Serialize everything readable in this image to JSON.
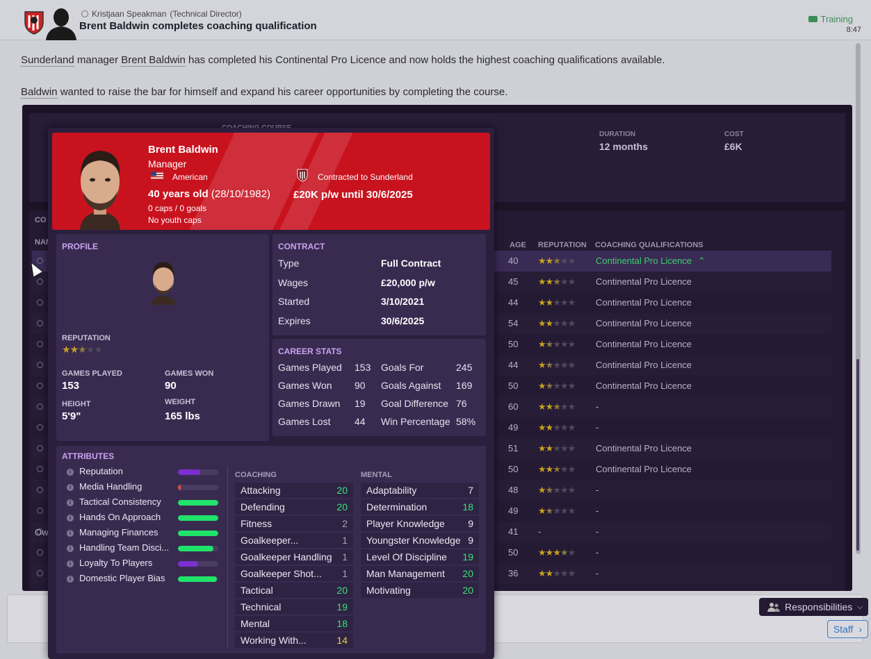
{
  "header": {
    "sender": "Kristjaan Speakman",
    "sender_role": "(Technical Director)",
    "subject": "Brent Baldwin completes coaching qualification",
    "category": "Training",
    "time": "8:47"
  },
  "message": {
    "p1": {
      "club": "Sunderland",
      "mid1": " manager ",
      "manager": "Brent Baldwin",
      "rest": " has completed his Continental Pro Licence and now holds the highest coaching qualifications available."
    },
    "p2": {
      "name": "Baldwin",
      "rest": " wanted to raise the bar for himself and expand his career opportunities by completing the course."
    }
  },
  "background_card": {
    "course_label": "COACHING COURSE",
    "duration_label": "DURATION",
    "duration": "12 months",
    "cost_label": "COST",
    "cost": "£6K",
    "section_title": "CO",
    "name_col": "NAM",
    "owner_label": "Ow",
    "columns": {
      "age": "AGE",
      "reputation": "REPUTATION",
      "qualifications": "COACHING QUALIFICATIONS"
    },
    "rows": [
      {
        "age": "40",
        "stars": 2.5,
        "qual": "Continental Pro Licence"
      },
      {
        "age": "45",
        "stars": 2.5,
        "qual": "Continental Pro Licence"
      },
      {
        "age": "44",
        "stars": 2,
        "qual": "Continental Pro Licence"
      },
      {
        "age": "54",
        "stars": 2,
        "qual": "Continental Pro Licence"
      },
      {
        "age": "50",
        "stars": 1.5,
        "qual": "Continental Pro Licence"
      },
      {
        "age": "44",
        "stars": 1.5,
        "qual": "Continental Pro Licence"
      },
      {
        "age": "50",
        "stars": 1.5,
        "qual": "Continental Pro Licence"
      },
      {
        "age": "60",
        "stars": 2.5,
        "qual": "-"
      },
      {
        "age": "49",
        "stars": 2,
        "qual": "-"
      },
      {
        "age": "51",
        "stars": 2,
        "qual": "Continental Pro Licence"
      },
      {
        "age": "50",
        "stars": 2.5,
        "qual": "Continental Pro Licence"
      },
      {
        "age": "48",
        "stars": 1.5,
        "qual": "-"
      },
      {
        "age": "49",
        "stars": 1.5,
        "qual": "-"
      },
      {
        "age": "41",
        "stars": null,
        "stars_text": "-",
        "qual": "-"
      },
      {
        "age": "50",
        "stars": 3.5,
        "qual": "-"
      },
      {
        "age": "36",
        "stars": 2,
        "qual": "-"
      }
    ]
  },
  "popup": {
    "name": "Brent Baldwin",
    "role": "Manager",
    "nationality": "American",
    "contract_status": "Contracted to Sunderland",
    "age_text": "40 years old",
    "dob": "(28/10/1982)",
    "wage_text": "£20K p/w until 30/6/2025",
    "caps": "0 caps / 0 goals",
    "youth": "No youth caps",
    "profile": {
      "title": "PROFILE",
      "rep_label": "REPUTATION",
      "rep_stars": 2.5,
      "games_played_label": "GAMES PLAYED",
      "games_played": "153",
      "games_won_label": "GAMES WON",
      "games_won": "90",
      "height_label": "HEIGHT",
      "height": "5'9\"",
      "weight_label": "WEIGHT",
      "weight": "165 lbs"
    },
    "contract": {
      "title": "CONTRACT",
      "rows": [
        {
          "k": "Type",
          "v": "Full Contract"
        },
        {
          "k": "Wages",
          "v": "£20,000 p/w"
        },
        {
          "k": "Started",
          "v": "3/10/2021"
        },
        {
          "k": "Expires",
          "v": "30/6/2025"
        }
      ]
    },
    "career": {
      "title": "CAREER STATS",
      "left": [
        {
          "k": "Games Played",
          "v": "153"
        },
        {
          "k": "Games Won",
          "v": "90"
        },
        {
          "k": "Games Drawn",
          "v": "19"
        },
        {
          "k": "Games Lost",
          "v": "44"
        }
      ],
      "right": [
        {
          "k": "Goals For",
          "v": "245"
        },
        {
          "k": "Goals Against",
          "v": "169"
        },
        {
          "k": "Goal Difference",
          "v": "76"
        },
        {
          "k": "Win Percentage",
          "v": "58%"
        }
      ]
    },
    "attributes": {
      "title": "ATTRIBUTES",
      "personal": [
        {
          "name": "Reputation",
          "level": 0.55,
          "color": "#7b2fd0"
        },
        {
          "name": "Media Handling",
          "level": 0.07,
          "color": "#e0503c"
        },
        {
          "name": "Tactical Consistency",
          "level": 1.0,
          "color": "#20e46a"
        },
        {
          "name": "Hands On Approach",
          "level": 1.0,
          "color": "#20e46a"
        },
        {
          "name": "Managing Finances",
          "level": 1.0,
          "color": "#20e46a"
        },
        {
          "name": "Handling Team Disci...",
          "level": 0.88,
          "color": "#20e46a"
        },
        {
          "name": "Loyalty To Players",
          "level": 0.5,
          "color": "#7b2fd0"
        },
        {
          "name": "Domestic Player Bias",
          "level": 0.97,
          "color": "#20e46a"
        }
      ],
      "coaching_label": "COACHING",
      "coaching": [
        {
          "name": "Attacking",
          "value": "20",
          "color": "#3ee07a"
        },
        {
          "name": "Defending",
          "value": "20",
          "color": "#3ee07a"
        },
        {
          "name": "Fitness",
          "value": "2",
          "color": "#a8a2b6"
        },
        {
          "name": "Goalkeeper...",
          "value": "1",
          "color": "#a8a2b6"
        },
        {
          "name": "Goalkeeper Handling",
          "value": "1",
          "color": "#a8a2b6"
        },
        {
          "name": "Goalkeeper Shot...",
          "value": "1",
          "color": "#a8a2b6"
        },
        {
          "name": "Tactical",
          "value": "20",
          "color": "#3ee07a"
        },
        {
          "name": "Technical",
          "value": "19",
          "color": "#3ee07a"
        },
        {
          "name": "Mental",
          "value": "18",
          "color": "#3ee07a"
        },
        {
          "name": "Working With...",
          "value": "14",
          "color": "#e6d33a"
        }
      ],
      "mental_label": "MENTAL",
      "mental": [
        {
          "name": "Adaptability",
          "value": "7",
          "color": "#ece8f4"
        },
        {
          "name": "Determination",
          "value": "18",
          "color": "#3ee07a"
        },
        {
          "name": "Player Knowledge",
          "value": "9",
          "color": "#ece8f4"
        },
        {
          "name": "Youngster Knowledge",
          "value": "9",
          "color": "#ece8f4"
        },
        {
          "name": "Level Of Discipline",
          "value": "19",
          "color": "#3ee07a"
        },
        {
          "name": "Man Management",
          "value": "20",
          "color": "#3ee07a"
        },
        {
          "name": "Motivating",
          "value": "20",
          "color": "#3ee07a"
        }
      ]
    }
  },
  "footer": {
    "responsibilities": "Responsibilities",
    "staff": "Staff"
  },
  "colors": {
    "banner": "#c8131f",
    "panel": "#392b50",
    "accent_purple": "#c9a3f0",
    "green": "#3ee07a"
  }
}
